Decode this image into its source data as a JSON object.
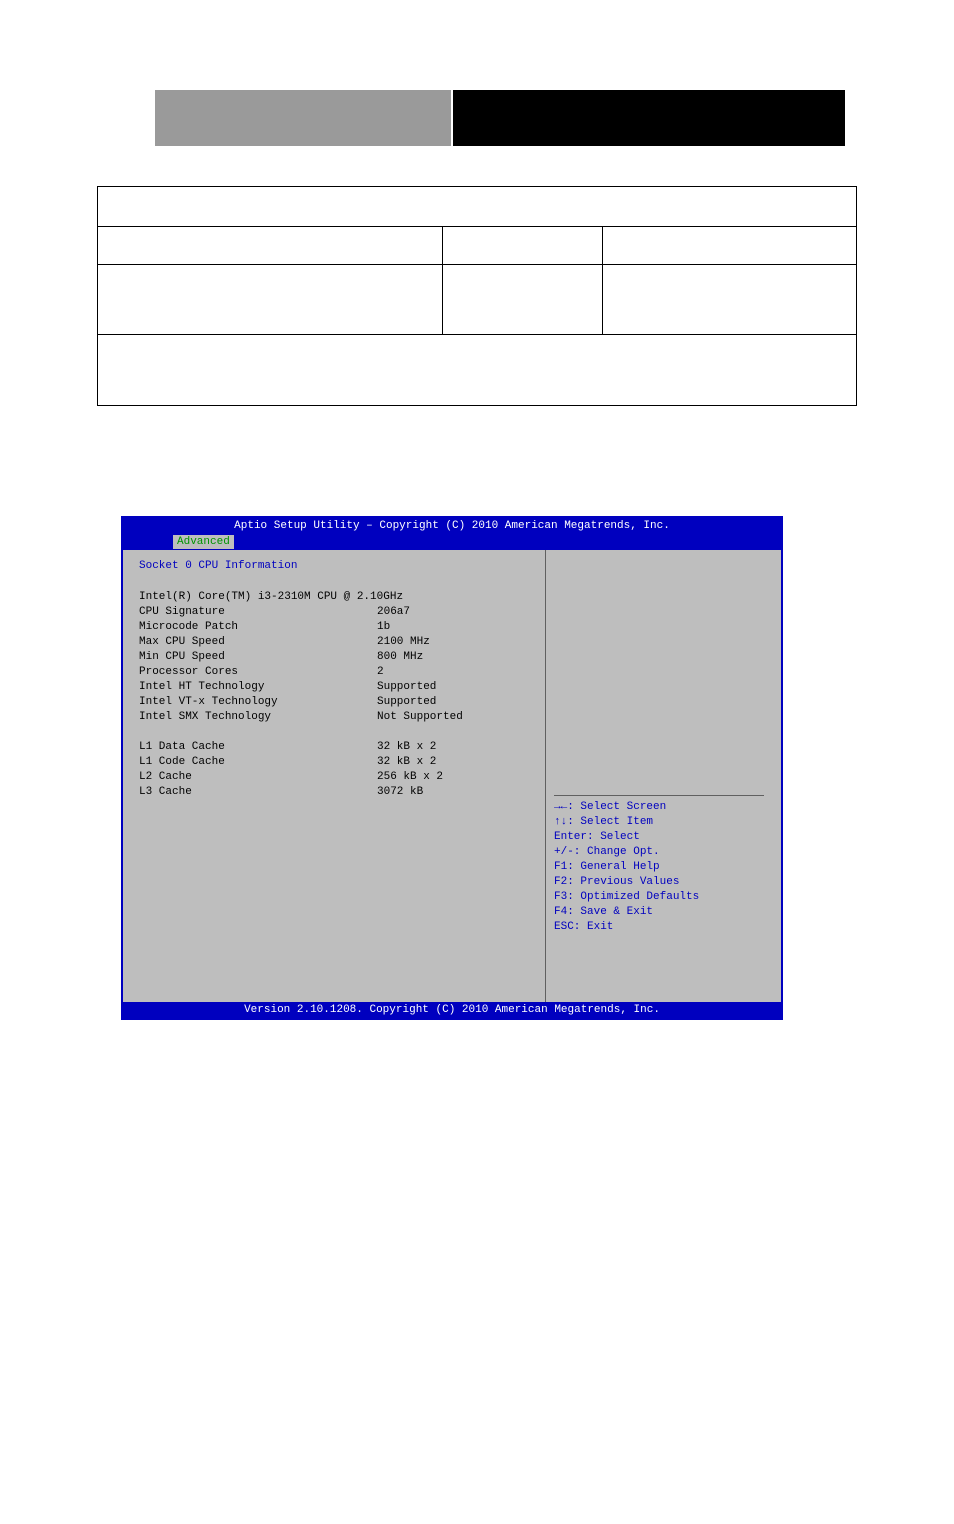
{
  "bios": {
    "title": "Aptio Setup Utility – Copyright (C) 2010 American Megatrends, Inc.",
    "tab": "Advanced",
    "footer": "Version 2.10.1208. Copyright (C) 2010 American Megatrends, Inc.",
    "section_title": "Socket 0 CPU Information",
    "cpu_name": "Intel(R) Core(TM) i3-2310M CPU @ 2.10GHz",
    "rows": [
      {
        "label": "CPU Signature",
        "value": "206a7"
      },
      {
        "label": "Microcode Patch",
        "value": "1b"
      },
      {
        "label": "Max CPU Speed",
        "value": "2100 MHz"
      },
      {
        "label": "Min CPU Speed",
        "value": "800 MHz"
      },
      {
        "label": "Processor Cores",
        "value": "2"
      },
      {
        "label": "Intel HT Technology",
        "value": "Supported"
      },
      {
        "label": "Intel VT-x Technology",
        "value": "Supported"
      },
      {
        "label": "Intel SMX Technology",
        "value": "Not Supported"
      }
    ],
    "cache": [
      {
        "label": "L1 Data Cache",
        "value": "32 kB x 2"
      },
      {
        "label": "L1 Code Cache",
        "value": "32 kB x 2"
      },
      {
        "label": "L2 Cache",
        "value": "256 kB x 2"
      },
      {
        "label": "L3 Cache",
        "value": "3072 kB"
      }
    ],
    "help": [
      "→←: Select Screen",
      "↑↓: Select Item",
      "Enter: Select",
      "+/-: Change Opt.",
      "F1: General Help",
      "F2: Previous Values",
      "F3: Optimized Defaults",
      "F4: Save & Exit",
      "ESC: Exit"
    ]
  }
}
